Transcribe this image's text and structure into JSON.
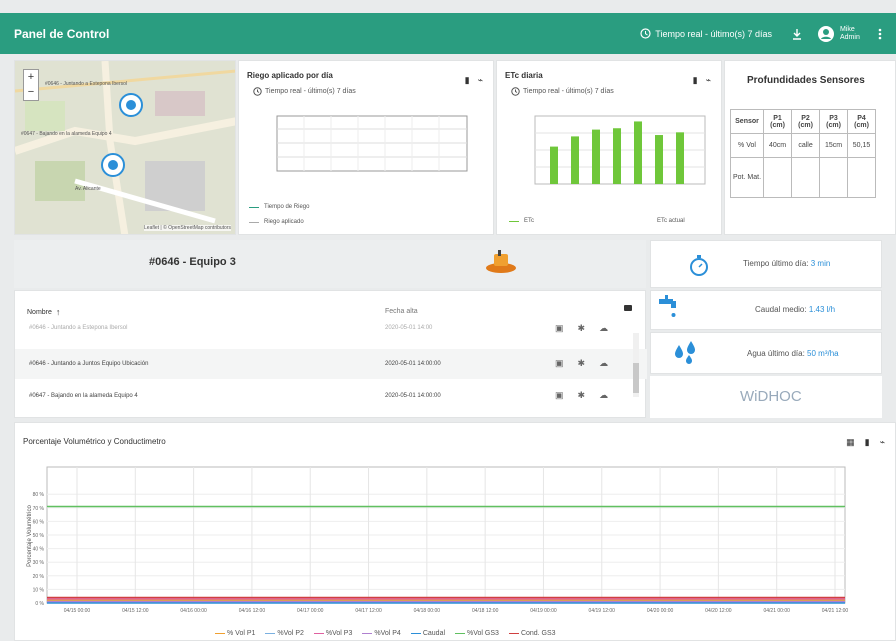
{
  "topbar": {
    "title": "Panel de Control",
    "time_filter": "Tiempo real - último(s) 7 días",
    "user_line1": "Mike",
    "user_line2": "Admin"
  },
  "map": {
    "marker1_label": "#0646 - Juntando a Estepona Ibersol",
    "marker2_label": "#0647 - Bajando en la alameda Equipo 4",
    "street": "Av. Alicante",
    "attribution": "Leaflet | © OpenStreetMap contributors"
  },
  "riego": {
    "title": "Riego aplicado por día",
    "subtitle": "Tiempo real - último(s) 7 días",
    "legend1": "Tiempo de Riego",
    "legend2": "Riego aplicado"
  },
  "etc": {
    "title": "ETc diaria",
    "subtitle": "Tiempo real - último(s) 7 días",
    "legend1": "ETc",
    "legend2": "ETc actual",
    "bars": [
      0.55,
      0.7,
      0.8,
      0.82,
      0.92,
      0.72,
      0.76
    ]
  },
  "sensores": {
    "title": "Profundidades Sensores",
    "head": [
      "Sensor",
      "P1 (cm)",
      "P2 (cm)",
      "P3 (cm)",
      "P4 (cm)"
    ],
    "row1": [
      "% Vol",
      "40cm",
      "calle",
      "15cm",
      "50,15"
    ],
    "row2": [
      "Pot. Mat.",
      "",
      "",
      "",
      ""
    ]
  },
  "device": {
    "title": "#0646 - Equipo 3"
  },
  "list": {
    "col_name": "Nombre",
    "col_date": "Fecha alta",
    "rows": [
      {
        "name": "#0646 - Juntando a Estepona Ibersol",
        "date": "2020-05-01 14:00"
      },
      {
        "name": "#0646 - Juntando a Juntos Equipo Ubicación",
        "date": "2020-05-01 14:00:00"
      },
      {
        "name": "#0647 - Bajando en la alameda Equipo 4",
        "date": "2020-05-01 14:00:00"
      }
    ]
  },
  "stats": {
    "t_label": "Tiempo último día:",
    "t_value": "3 min",
    "c_label": "Caudal medio:",
    "c_value": "1.43 l/h",
    "a_label": "Agua último día:",
    "a_value": "50 m³/ha",
    "logo": "WiDHOC"
  },
  "main_chart": {
    "title": "Porcentaje Volumétrico y Conductimetro",
    "ylabel": "Porcentaje Volumétrico"
  },
  "chart_data": {
    "type": "line",
    "title": "Porcentaje Volumétrico y Conductimetro",
    "ylabel": "Porcentaje Volumétrico",
    "ylim": [
      0,
      100
    ],
    "y_ticks": [
      "0 %",
      "10 %",
      "20 %",
      "30 %",
      "40 %",
      "50 %",
      "60 %",
      "70 %",
      "80 %"
    ],
    "x_ticks": [
      "04/15 00:00",
      "04/15 12:00",
      "04/16 00:00",
      "04/16 12:00",
      "04/17 00:00",
      "04/17 12:00",
      "04/18 00:00",
      "04/18 12:00",
      "04/19 00:00",
      "04/19 12:00",
      "04/20 00:00",
      "04/20 12:00",
      "04/21 00:00",
      "04/21 12:00"
    ],
    "series": [
      {
        "name": "% Vol P1",
        "color": "#f0a030",
        "values": [
          2,
          2,
          2,
          2,
          2,
          2,
          2,
          2,
          2,
          2,
          2,
          2,
          2,
          2
        ]
      },
      {
        "name": "%Vol P2",
        "color": "#7ab0e0",
        "values": [
          1,
          1,
          1,
          1,
          1,
          1,
          1,
          1,
          1,
          1,
          1,
          1,
          1,
          1
        ]
      },
      {
        "name": "%Vol P3",
        "color": "#e060a0",
        "values": [
          3,
          3,
          3,
          3,
          3,
          3,
          3,
          3,
          3,
          3,
          3,
          3,
          3,
          3
        ]
      },
      {
        "name": "%Vol P4",
        "color": "#b080d0",
        "values": [
          1,
          1,
          1,
          1,
          1,
          1,
          1,
          1,
          1,
          1,
          1,
          1,
          1,
          1
        ]
      },
      {
        "name": "Caudal",
        "color": "#2b8fd8",
        "values": [
          0,
          0,
          0,
          0,
          0,
          0,
          0,
          0,
          0,
          0,
          0,
          0,
          0,
          0
        ]
      },
      {
        "name": "%Vol GS3",
        "color": "#60c060",
        "values": [
          71,
          71,
          71,
          71,
          71,
          71,
          71,
          71,
          71,
          71,
          71,
          71,
          71,
          71
        ]
      },
      {
        "name": "Cond. GS3",
        "color": "#d04040",
        "values": [
          4,
          4,
          4,
          4,
          4,
          4,
          4,
          4,
          4,
          4,
          4,
          4,
          4,
          4
        ]
      }
    ]
  },
  "colors": {
    "brand": "#2a9d80",
    "accent": "#2b8fd8",
    "bar": "#6fc73a"
  }
}
